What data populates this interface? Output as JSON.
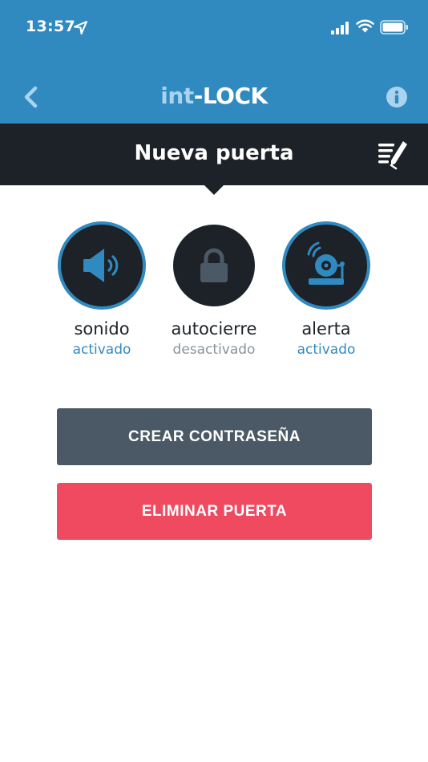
{
  "status_bar": {
    "time": "13:57"
  },
  "header": {
    "app_name_prefix": "int",
    "app_name_suffix": "-LOCK"
  },
  "subheader": {
    "title": "Nueva puerta"
  },
  "features": [
    {
      "name": "sonido",
      "state": "activado",
      "enabled": true,
      "icon": "speaker-icon"
    },
    {
      "name": "autocierre",
      "state": "desactivado",
      "enabled": false,
      "icon": "padlock-icon"
    },
    {
      "name": "alerta",
      "state": "activado",
      "enabled": true,
      "icon": "alarm-bell-icon"
    }
  ],
  "actions": {
    "create_password": "CREAR CONTRASEÑA",
    "delete_door": "ELIMINAR PUERTA"
  },
  "colors": {
    "brand_blue": "#3089bf",
    "dark": "#1c2227",
    "slate_button": "#4b5966",
    "danger_button": "#ef4a5f",
    "inactive_gray": "#8a929a"
  }
}
